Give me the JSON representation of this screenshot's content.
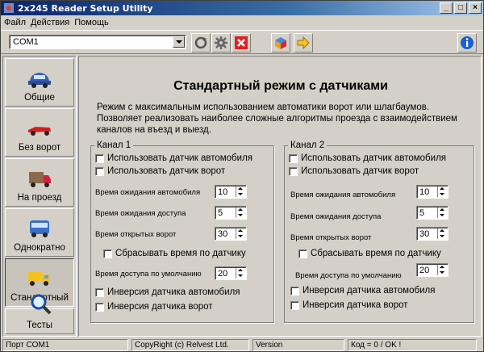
{
  "window": {
    "title": "2x245 Reader Setup Utility"
  },
  "menu": [
    "Файл",
    "Действия",
    "Помощь"
  ],
  "toolbar": {
    "port_value": "COM1"
  },
  "nav": [
    {
      "label": "Общие",
      "icon": "car-icon"
    },
    {
      "label": "Без ворот",
      "icon": "race-car-icon"
    },
    {
      "label": "На проезд",
      "icon": "truck-icon"
    },
    {
      "label": "Однократно",
      "icon": "bus-icon"
    },
    {
      "label": "Стандартный",
      "icon": "dump-truck-icon",
      "active": true
    },
    {
      "label": "Тесты",
      "icon": "magnifier-icon"
    }
  ],
  "main": {
    "heading": "Стандартный режим с датчиками",
    "description": "Режим с максимальным использованием автоматики ворот или шлагбаумов. Позволяет реализовать наиболее сложные алгоритмы проезда с взаимодействием каналов на въезд и выезд."
  },
  "channel1": {
    "legend": "Канал 1",
    "use_car_sensor": "Использовать датчик автомобиля",
    "use_gate_sensor": "Использовать датчик ворот",
    "wait_car_label": "Время ожидания автомобиля",
    "wait_car_value": "10",
    "wait_access_label": "Время ожидания доступа",
    "wait_access_value": "5",
    "gate_open_label": "Время открытых ворот",
    "gate_open_value": "30",
    "reset_time": "Сбрасывать время по датчику",
    "default_access_label": "Время доступа по умолчанию",
    "default_access_value": "20",
    "invert_car": "Инверсия датчика автомобиля",
    "invert_gate": "Инверсия датчика ворот"
  },
  "channel2": {
    "legend": "Канал 2",
    "use_car_sensor": "Использовать датчик автомобиля",
    "use_gate_sensor": "Использовать датчик ворот",
    "wait_car_label": "Время ожидания автомобиля",
    "wait_car_value": "10",
    "wait_access_label": "Время ожидания доступа",
    "wait_access_value": "5",
    "gate_open_label": "Время открытых ворот",
    "gate_open_value": "30",
    "reset_time": "Сбрасывать время по датчику",
    "default_access_label": "Время доступа по умолчанию",
    "default_access_value": "20",
    "invert_car": "Инверсия датчика автомобиля",
    "invert_gate": "Инверсия датчика ворот"
  },
  "status": {
    "port": "Порт COM1",
    "copyright": "CopyRight (c) Relvest Ltd.",
    "version": "Version",
    "code": "Код = 0 / OK !"
  },
  "colors": {
    "title_start": "#0a246a",
    "title_end": "#a6caf0",
    "face": "#d4d0c8"
  }
}
